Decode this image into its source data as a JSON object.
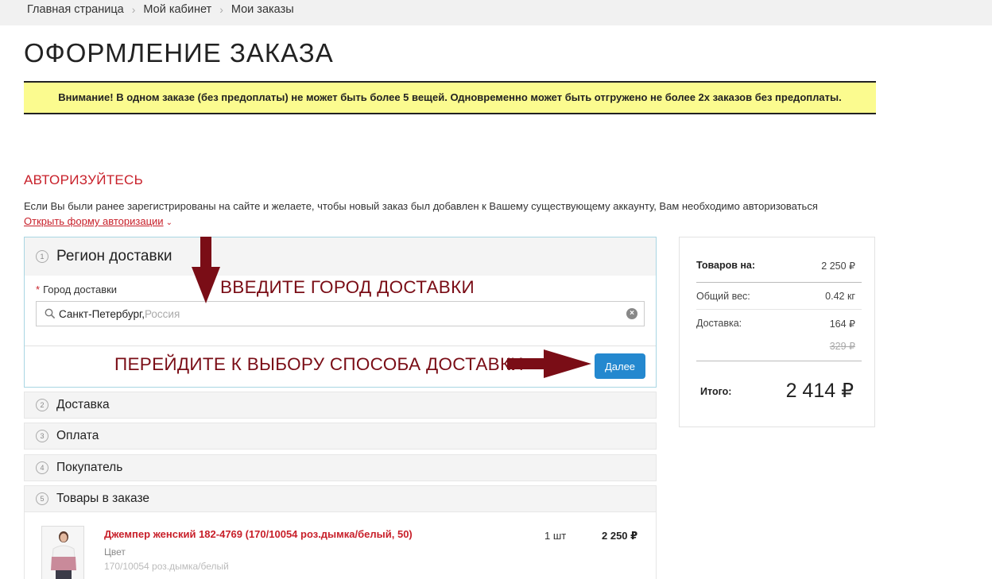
{
  "breadcrumb": [
    "Главная страница",
    "Мой кабинет",
    "Мои заказы"
  ],
  "page_title": "ОФОРМЛЕНИЕ ЗАКАЗА",
  "notice": "Внимание! В одном заказе (без предоплаты) не может быть более 5 вещей. Одновременно может быть отгружено не более 2х заказов без предоплаты.",
  "auth": {
    "title": "АВТОРИЗУЙТЕСЬ",
    "text": "Если Вы были ранее зарегистрированы на сайте и желаете, чтобы новый заказ был добавлен к Вашему существующему аккаунту, Вам необходимо авторизоваться",
    "link": "Открыть форму авторизации"
  },
  "steps": [
    {
      "num": "1",
      "title": "Регион доставки"
    },
    {
      "num": "2",
      "title": "Доставка"
    },
    {
      "num": "3",
      "title": "Оплата"
    },
    {
      "num": "4",
      "title": "Покупатель"
    },
    {
      "num": "5",
      "title": "Товары в заказе"
    }
  ],
  "region": {
    "label_required": "*",
    "label": "Город доставки",
    "city_value": "Санкт-Петербург,",
    "city_country": " Россия",
    "next_label": "Далее"
  },
  "annotations": {
    "enter_city": "ВВЕДИТЕ ГОРОД ДОСТАВКИ",
    "go_to_delivery": "ПЕРЕЙДИТЕ К ВЫБОРУ СПОСОБА ДОСТАВКИ",
    "arrow_color": "#7a0d16"
  },
  "product": {
    "name": "Джемпер женский 182-4769 (170/10054 роз.дымка/белый, 50)",
    "attr_label": "Цвет",
    "attr_value": "170/10054 роз.дымка/белый",
    "qty": "1 шт",
    "price": "2 250 ₽"
  },
  "summary": {
    "goods_label": "Товаров на:",
    "goods_value": "2 250 ₽",
    "weight_label": "Общий вес:",
    "weight_value": "0.42 кг",
    "delivery_label": "Доставка:",
    "delivery_value": "164 ₽",
    "delivery_old": "329 ₽",
    "total_label": "Итого:",
    "total_value": "2 414 ₽"
  },
  "colors": {
    "accent_red": "#c8202a",
    "notice_bg": "#fbfb8f",
    "button_blue": "#2488cf",
    "step_border": "#a9d6e3"
  }
}
